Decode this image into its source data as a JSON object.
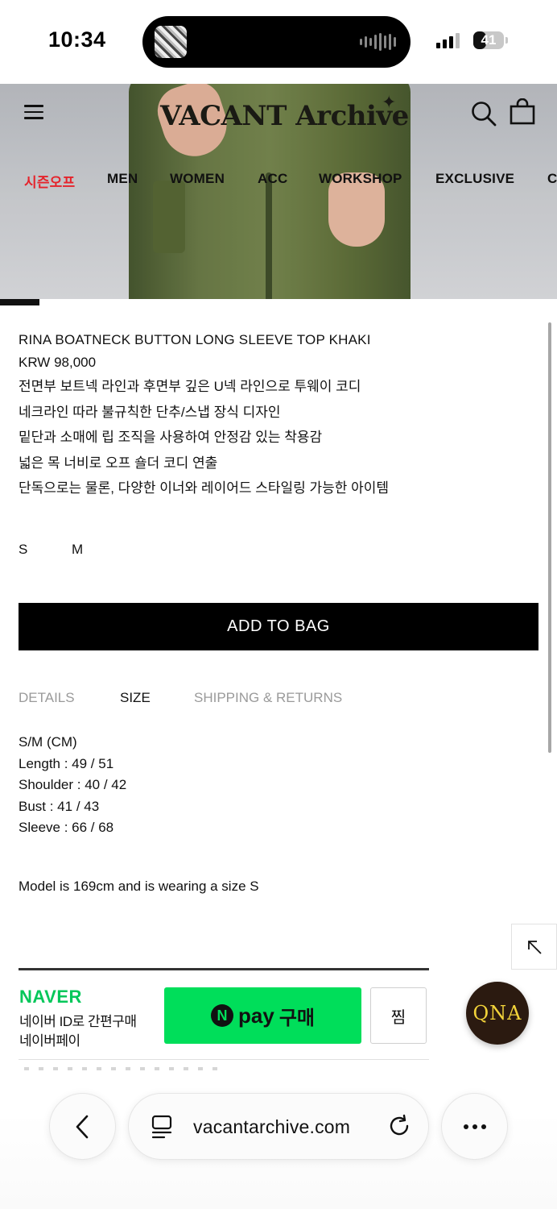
{
  "status_bar": {
    "time": "10:34",
    "battery": "41",
    "battery_level": 0.41
  },
  "header": {
    "logo": "VACANT Archive",
    "nav": [
      "시즌오프",
      "MEN",
      "WOMEN",
      "ACC",
      "WORKSHOP",
      "EXCLUSIVE",
      "C"
    ],
    "sale_color": "#e5232b"
  },
  "product": {
    "title": "RINA BOATNECK BUTTON LONG SLEEVE TOP KHAKI",
    "price": "KRW 98,000",
    "description": [
      "전면부 보트넥 라인과 후면부 깊은 U넥 라인으로 투웨이 코디",
      "네크라인 따라 불규칙한 단추/스냅 장식 디자인",
      "밑단과 소매에 립 조직을 사용하여 안정감 있는 착용감",
      "넓은 목 너비로 오프 숄더 코디 연출",
      "단독으로는 물론, 다양한 이너와 레이어드 스타일링 가능한 아이템"
    ],
    "sizes": [
      "S",
      "M"
    ],
    "add_to_bag": "ADD TO BAG"
  },
  "info_tabs": {
    "items": [
      "DETAILS",
      "SIZE",
      "SHIPPING & RETURNS"
    ],
    "active": "SIZE"
  },
  "size_chart": {
    "lines": [
      "S/M (CM)",
      "Length : 49 / 51",
      "Shoulder : 40 / 42",
      "Bust : 41 / 43",
      "Sleeve : 66 / 68"
    ],
    "model_note": "Model is 169cm and is wearing a size S"
  },
  "naver_pay": {
    "brand": "NAVER",
    "line1": "네이버 ID로 간편구매",
    "line2": "네이버페이",
    "pay_n": "N",
    "pay_word": "pay",
    "pay_buy": "구매",
    "wish": "찜",
    "brand_color": "#03c75a",
    "button_color": "#00de5a"
  },
  "qna": "QNA",
  "browser": {
    "url": "vacantarchive.com"
  }
}
